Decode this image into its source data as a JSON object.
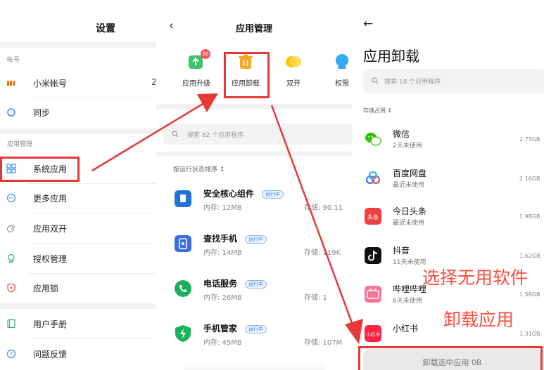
{
  "settings": {
    "title": "设置",
    "sections": [
      {
        "label": "帐号"
      },
      {
        "label": "应用管理"
      }
    ],
    "items": [
      {
        "label": "小米帐号",
        "extra": "2"
      },
      {
        "label": "同步"
      },
      {
        "label": "系统应用"
      },
      {
        "label": "更多应用"
      },
      {
        "label": "应用双开"
      },
      {
        "label": "授权管理"
      },
      {
        "label": "应用锁"
      },
      {
        "label": "用户手册"
      },
      {
        "label": "问题反馈"
      }
    ]
  },
  "app_management": {
    "title": "应用管理",
    "tools": [
      {
        "label": "应用升级",
        "badge": "20"
      },
      {
        "label": "应用卸载"
      },
      {
        "label": "双开"
      },
      {
        "label": "权限"
      }
    ],
    "search_placeholder": "搜索 82 个应用程序",
    "sort_label": "按运行状态排序",
    "running_tag": "运行中",
    "apps": [
      {
        "name": "安全核心组件",
        "memory": "内存: 12MB",
        "storage": "存储: 90.11"
      },
      {
        "name": "查找手机",
        "memory": "内存: 14MB",
        "storage": "存储: 119K"
      },
      {
        "name": "电话服务",
        "memory": "内存: 26MB",
        "storage": "存储: 1"
      },
      {
        "name": "手机管家",
        "memory": "内存: 45MB",
        "storage": "存储: 107M"
      }
    ]
  },
  "uninstall": {
    "title": "应用卸载",
    "search_placeholder": "搜索 18 个应用程序",
    "sort_label": "存储占用",
    "apps": [
      {
        "name": "微信",
        "last_used": "2天未使用",
        "size": "2.75GB",
        "color": "#2dc100"
      },
      {
        "name": "百度网盘",
        "last_used": "最近未使用",
        "size": "2.16GB",
        "color": "#3d7df5"
      },
      {
        "name": "今日头条",
        "last_used": "最近未使用",
        "size": "1.98GB",
        "color": "#f04142"
      },
      {
        "name": "抖音",
        "last_used": "11天未使用",
        "size": "1.62GB",
        "color": "#111111"
      },
      {
        "name": "哔哩哔哩",
        "last_used": "6天未使用",
        "size": "1.58GB",
        "color": "#fb7299"
      },
      {
        "name": "小红书",
        "last_used": "",
        "size": "1.31GB",
        "color": "#ff2442"
      }
    ],
    "button_label": "卸载选中应用 0B"
  },
  "annotations": {
    "select_text": "选择无用软件",
    "uninstall_text": "卸载应用"
  },
  "colors": {
    "highlight": "#e53935",
    "annotation_text": "#ff4d3d",
    "accent_blue": "#2f7ae5"
  }
}
